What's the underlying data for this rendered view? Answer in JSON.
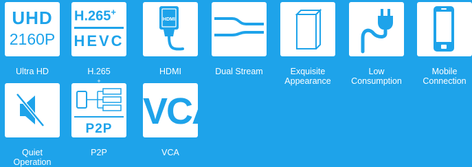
{
  "brand_colors": {
    "background": "#1ea3ea",
    "tile": "#ffffff",
    "accent": "#1ea3ea"
  },
  "features": [
    {
      "icon_name": "uhd-2160p-icon",
      "tile_text_top": "UHD",
      "tile_text_bottom": "2160P",
      "caption": "Ultra HD"
    },
    {
      "icon_name": "h265-hevc-icon",
      "tile_text_top": "H.265",
      "tile_text_sup": "+",
      "tile_text_bottom": "HEVC",
      "caption": "H.265",
      "caption_sup": "+"
    },
    {
      "icon_name": "hdmi-cable-icon",
      "tile_text": "HDMI",
      "caption": "HDMI"
    },
    {
      "icon_name": "dual-stream-icon",
      "caption": "Dual Stream"
    },
    {
      "icon_name": "box-icon",
      "caption_line1": "Exquisite",
      "caption_line2": "Appearance"
    },
    {
      "icon_name": "power-plug-icon",
      "caption_line1": "Low",
      "caption_line2": "Consumption"
    },
    {
      "icon_name": "mobile-phone-icon",
      "caption_line1": "Mobile",
      "caption_line2": "Connection"
    },
    {
      "icon_name": "speaker-mute-icon",
      "caption_line1": "Quiet",
      "caption_line2": "Operation"
    },
    {
      "icon_name": "p2p-network-icon",
      "tile_text": "P2P",
      "caption": "P2P"
    },
    {
      "icon_name": "vca-icon",
      "tile_text": "VCA",
      "caption": "VCA"
    }
  ]
}
